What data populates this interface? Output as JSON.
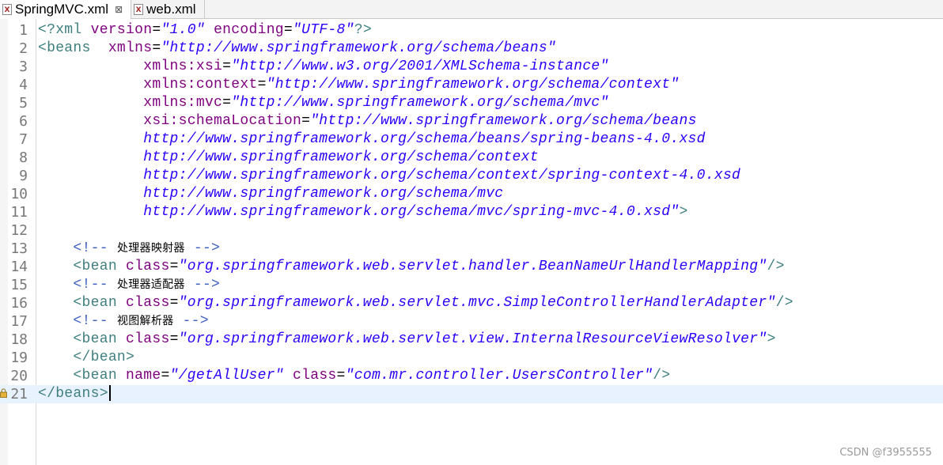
{
  "tabs": [
    {
      "label": "SpringMVC.xml",
      "icon": "xml-file-icon",
      "close": "⊠"
    },
    {
      "label": "web.xml",
      "icon": "xml-file-icon"
    }
  ],
  "tab_icon_text": "X",
  "current_line": 21,
  "watermark": "CSDN @f3955555",
  "lines": [
    {
      "n": "1",
      "spans": [
        [
          "t",
          "<?xml "
        ],
        [
          "a",
          "version"
        ],
        [
          "p",
          "="
        ],
        [
          "v",
          "\"1.0\""
        ],
        [
          "p",
          " "
        ],
        [
          "a",
          "encoding"
        ],
        [
          "p",
          "="
        ],
        [
          "v",
          "\"UTF-8\""
        ],
        [
          "t",
          "?>"
        ]
      ]
    },
    {
      "n": "2",
      "spans": [
        [
          "t",
          "<beans  "
        ],
        [
          "a",
          "xmlns"
        ],
        [
          "p",
          "="
        ],
        [
          "v",
          "\"http://www.springframework.org/schema/beans\""
        ]
      ]
    },
    {
      "n": "3",
      "spans": [
        [
          "p",
          "            "
        ],
        [
          "a",
          "xmlns:xsi"
        ],
        [
          "p",
          "="
        ],
        [
          "v",
          "\"http://www.w3.org/2001/XMLSchema-instance\""
        ]
      ]
    },
    {
      "n": "4",
      "spans": [
        [
          "p",
          "            "
        ],
        [
          "a",
          "xmlns:context"
        ],
        [
          "p",
          "="
        ],
        [
          "v",
          "\"http://www.springframework.org/schema/context\""
        ]
      ]
    },
    {
      "n": "5",
      "spans": [
        [
          "p",
          "            "
        ],
        [
          "a",
          "xmlns:mvc"
        ],
        [
          "p",
          "="
        ],
        [
          "v",
          "\"http://www.springframework.org/schema/mvc\""
        ]
      ]
    },
    {
      "n": "6",
      "spans": [
        [
          "p",
          "            "
        ],
        [
          "a",
          "xsi:schemaLocation"
        ],
        [
          "p",
          "="
        ],
        [
          "v",
          "\"http://www.springframework.org/schema/beans"
        ]
      ]
    },
    {
      "n": "7",
      "spans": [
        [
          "p",
          "            "
        ],
        [
          "v",
          "http://www.springframework.org/schema/beans/spring-beans-4.0.xsd"
        ]
      ]
    },
    {
      "n": "8",
      "spans": [
        [
          "p",
          "            "
        ],
        [
          "v",
          "http://www.springframework.org/schema/context"
        ]
      ]
    },
    {
      "n": "9",
      "spans": [
        [
          "p",
          "            "
        ],
        [
          "v",
          "http://www.springframework.org/schema/context/spring-context-4.0.xsd"
        ]
      ]
    },
    {
      "n": "10",
      "spans": [
        [
          "p",
          "            "
        ],
        [
          "v",
          "http://www.springframework.org/schema/mvc"
        ]
      ]
    },
    {
      "n": "11",
      "spans": [
        [
          "p",
          "            "
        ],
        [
          "v",
          "http://www.springframework.org/schema/mvc/spring-mvc-4.0.xsd\""
        ],
        [
          "t",
          ">"
        ]
      ]
    },
    {
      "n": "12",
      "spans": []
    },
    {
      "n": "13",
      "spans": [
        [
          "p",
          "    "
        ],
        [
          "c",
          "<!-- "
        ],
        [
          "cjk",
          "处理器映射器"
        ],
        [
          "c",
          " -->"
        ]
      ]
    },
    {
      "n": "14",
      "spans": [
        [
          "p",
          "    "
        ],
        [
          "t",
          "<bean "
        ],
        [
          "a",
          "class"
        ],
        [
          "p",
          "="
        ],
        [
          "v",
          "\"org.springframework.web.servlet.handler.BeanNameUrlHandlerMapping\""
        ],
        [
          "t",
          "/>"
        ]
      ]
    },
    {
      "n": "15",
      "spans": [
        [
          "p",
          "    "
        ],
        [
          "c",
          "<!-- "
        ],
        [
          "cjk",
          "处理器适配器"
        ],
        [
          "c",
          " -->"
        ]
      ]
    },
    {
      "n": "16",
      "spans": [
        [
          "p",
          "    "
        ],
        [
          "t",
          "<bean "
        ],
        [
          "a",
          "class"
        ],
        [
          "p",
          "="
        ],
        [
          "v",
          "\"org.springframework.web.servlet.mvc.SimpleControllerHandlerAdapter\""
        ],
        [
          "t",
          "/>"
        ]
      ]
    },
    {
      "n": "17",
      "spans": [
        [
          "p",
          "    "
        ],
        [
          "c",
          "<!-- "
        ],
        [
          "cjk",
          "视图解析器"
        ],
        [
          "c",
          " -->"
        ]
      ]
    },
    {
      "n": "18",
      "spans": [
        [
          "p",
          "    "
        ],
        [
          "t",
          "<bean "
        ],
        [
          "a",
          "class"
        ],
        [
          "p",
          "="
        ],
        [
          "v",
          "\"org.springframework.web.servlet.view.InternalResourceViewResolver\""
        ],
        [
          "t",
          ">"
        ]
      ]
    },
    {
      "n": "19",
      "spans": [
        [
          "p",
          "    "
        ],
        [
          "t",
          "</bean>"
        ]
      ]
    },
    {
      "n": "20",
      "spans": [
        [
          "p",
          "    "
        ],
        [
          "t",
          "<bean "
        ],
        [
          "a",
          "name"
        ],
        [
          "p",
          "="
        ],
        [
          "v",
          "\"/getAllUser\""
        ],
        [
          "p",
          " "
        ],
        [
          "a",
          "class"
        ],
        [
          "p",
          "="
        ],
        [
          "v",
          "\"com.mr.controller.UsersController\""
        ],
        [
          "t",
          "/>"
        ]
      ]
    },
    {
      "n": "21",
      "spans": [
        [
          "t",
          "</beans>"
        ]
      ]
    }
  ],
  "colors": {
    "tag": "#3f7f7f",
    "attribute": "#7f007f",
    "value": "#2a00ff",
    "comment": "#3f5fbf",
    "current_line": "#e8f2fe"
  }
}
